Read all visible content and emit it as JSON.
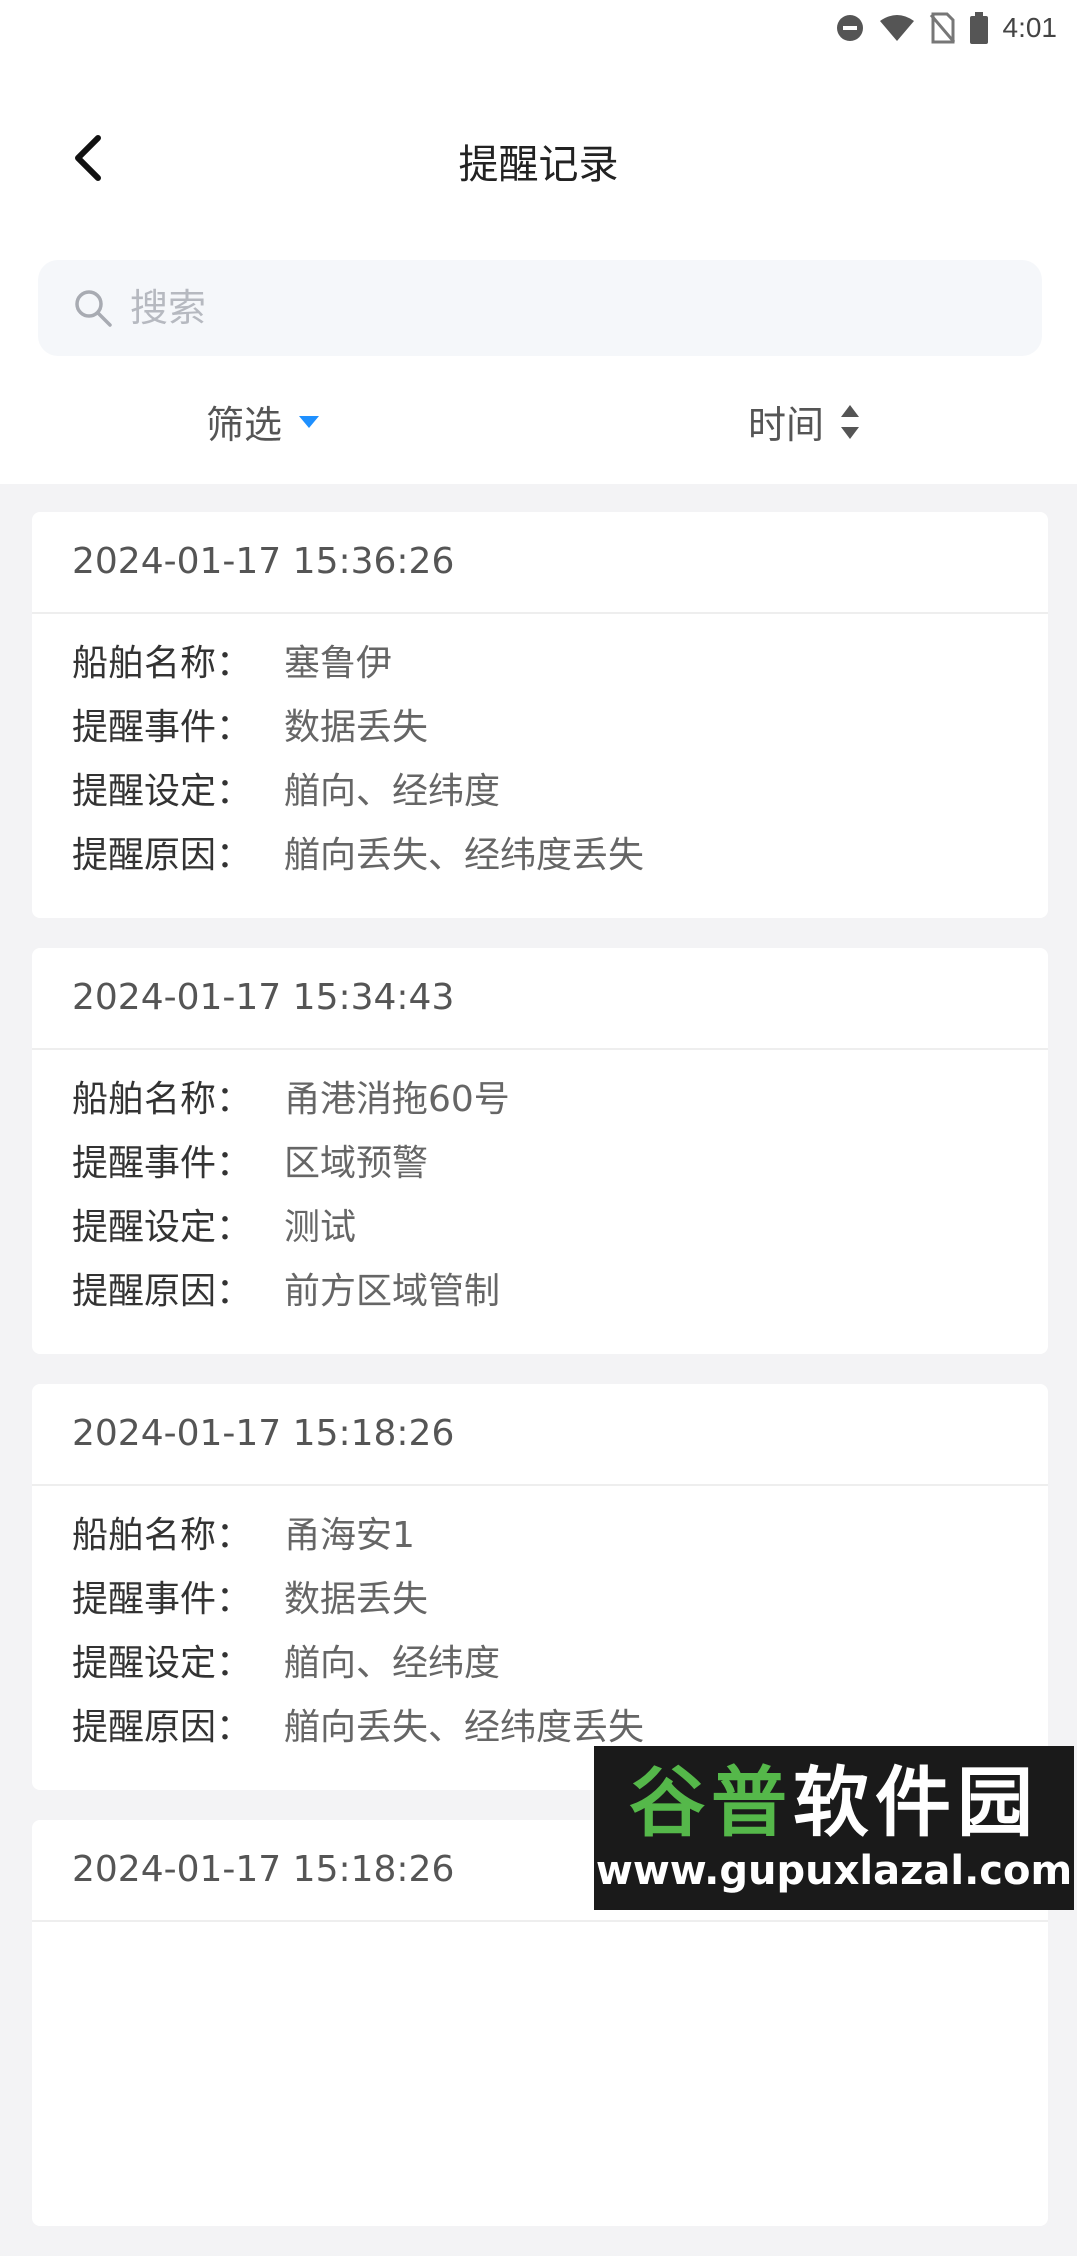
{
  "status_bar": {
    "time": "4:01",
    "icons": [
      "do-not-disturb-icon",
      "wifi-icon",
      "no-sim-icon",
      "battery-icon"
    ]
  },
  "header": {
    "title": "提醒记录",
    "back_icon": "chevron-left-icon"
  },
  "search": {
    "placeholder": "搜索",
    "value": ""
  },
  "filter_bar": {
    "filter_label": "筛选",
    "sort_label": "时间"
  },
  "colors": {
    "accent": "#1e90ff",
    "background": "#f3f3f5"
  },
  "records": [
    {
      "time": "2024-01-17 15:36:26",
      "fields": [
        {
          "label": "船舶名称：",
          "value": "塞鲁伊"
        },
        {
          "label": "提醒事件：",
          "value": "数据丢失"
        },
        {
          "label": "提醒设定：",
          "value": "艏向、经纬度"
        },
        {
          "label": "提醒原因：",
          "value": "艏向丢失、经纬度丢失"
        }
      ]
    },
    {
      "time": "2024-01-17 15:34:43",
      "fields": [
        {
          "label": "船舶名称：",
          "value": "甬港消拖60号"
        },
        {
          "label": "提醒事件：",
          "value": "区域预警"
        },
        {
          "label": "提醒设定：",
          "value": "测试"
        },
        {
          "label": "提醒原因：",
          "value": "前方区域管制"
        }
      ]
    },
    {
      "time": "2024-01-17 15:18:26",
      "fields": [
        {
          "label": "船舶名称：",
          "value": "甬海安1"
        },
        {
          "label": "提醒事件：",
          "value": "数据丢失"
        },
        {
          "label": "提醒设定：",
          "value": "艏向、经纬度"
        },
        {
          "label": "提醒原因：",
          "value": "艏向丢失、经纬度丢失"
        }
      ]
    },
    {
      "time": "2024-01-17 15:18:26",
      "fields": []
    }
  ],
  "watermark": {
    "title_a": "谷普",
    "title_b": "软件园",
    "url": "www.gupuxlazal.com"
  }
}
